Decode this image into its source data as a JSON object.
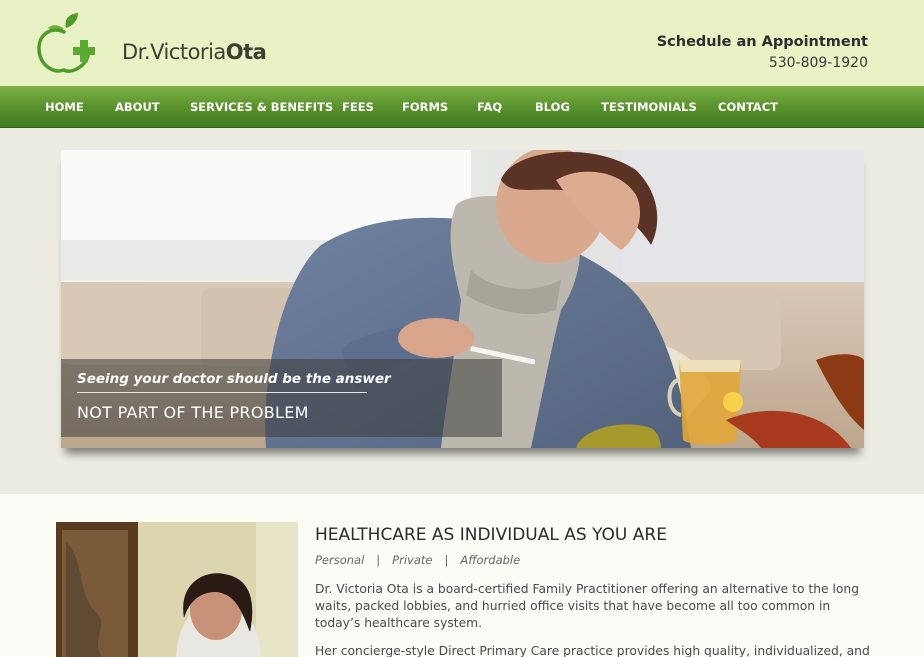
{
  "header": {
    "brand_prefix": "Dr.",
    "brand_first": "Victoria",
    "brand_last": "Ota",
    "appointment_title": "Schedule an Appointment",
    "appointment_phone": "530-809-1920"
  },
  "nav": {
    "items": [
      {
        "label": "HOME"
      },
      {
        "label": "ABOUT"
      },
      {
        "label": "SERVICES & BENEFITS"
      },
      {
        "label": "FEES"
      },
      {
        "label": "FORMS"
      },
      {
        "label": "FAQ"
      },
      {
        "label": "BLOG"
      },
      {
        "label": "TESTIMONIALS"
      },
      {
        "label": "CONTACT"
      }
    ]
  },
  "hero": {
    "caption_line1": "Seeing your doctor should be the answer",
    "caption_line2": "NOT PART OF THE PROBLEM"
  },
  "content": {
    "title": "HEALTHCARE AS INDIVIDUAL AS YOU ARE",
    "tags": [
      "Personal",
      "Private",
      "Affordable"
    ],
    "tag_separator": "|",
    "paragraph1": "Dr. Victoria Ota is a board-certified Family Practitioner offering an alternative to the long waits, packed lobbies, and hurried office visits that have become all too common in today’s healthcare system.",
    "paragraph2": "Her concierge-style Direct Primary Care practice provides high quality, individualized, and"
  },
  "colors": {
    "header_bg": "#e8f2c4",
    "nav_green": "#5d962f",
    "hero_band_bg": "#ecece2",
    "content_bg": "#fbfcf6",
    "logo_green": "#4f9b2a"
  },
  "icons": {
    "logo": "apple-cross-logo-icon"
  }
}
